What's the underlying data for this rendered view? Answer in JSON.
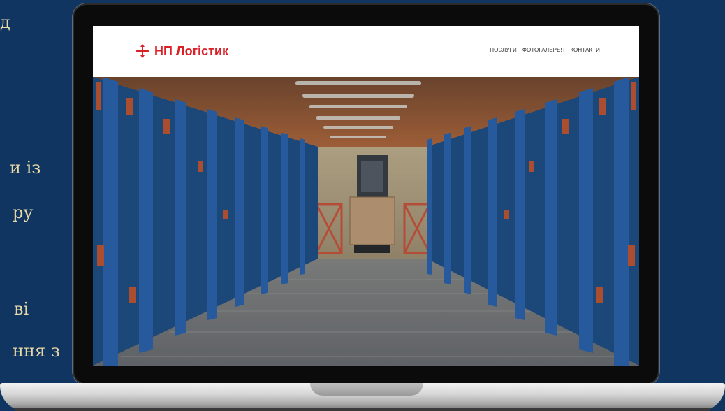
{
  "slide": {
    "partial_lines": [
      "д",
      "и із",
      "ру",
      "ві",
      "ння з"
    ]
  },
  "website": {
    "logo": {
      "icon": "np-logo-icon",
      "text": "НП Логістик",
      "color": "#da2128"
    },
    "nav": {
      "items": [
        "ПОСЛУГИ",
        "ФОТОГАЛЕРЕЯ",
        "КОНТАКТИ"
      ]
    }
  },
  "colors": {
    "background": "#0f3560",
    "slide_text": "#e9d9a6",
    "brand_red": "#da2128"
  }
}
